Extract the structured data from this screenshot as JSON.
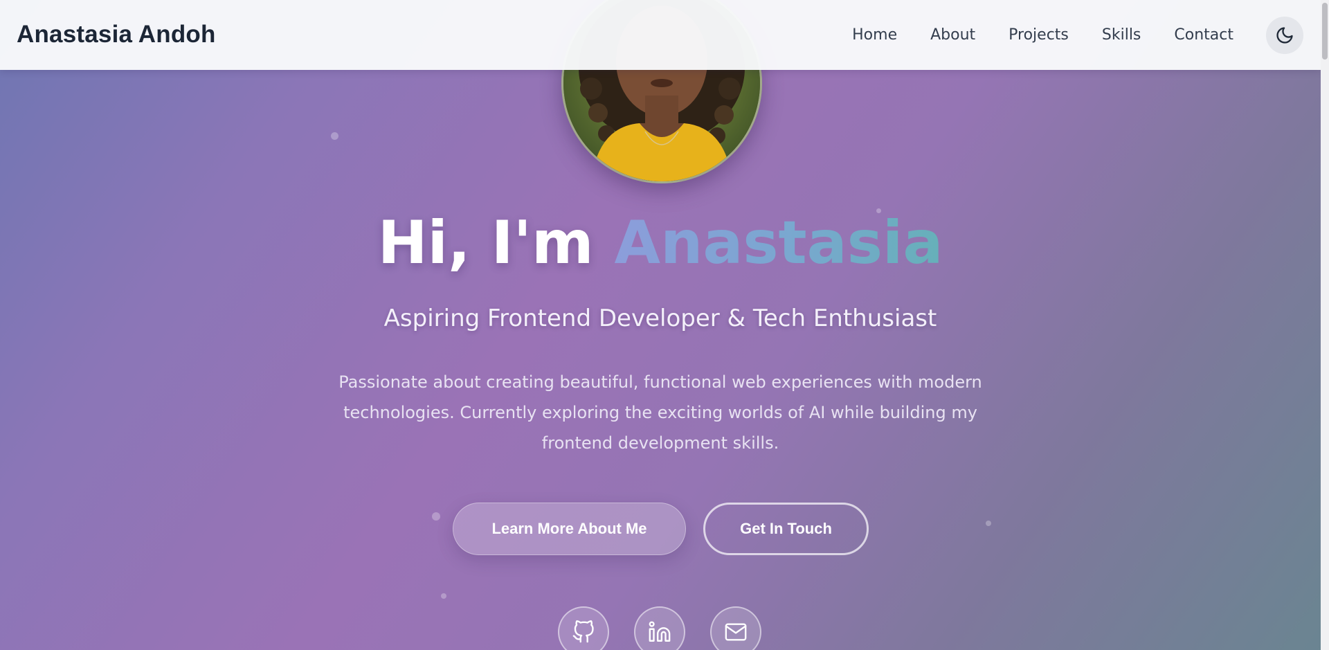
{
  "brand": {
    "name": "Anastasia Andoh"
  },
  "nav": {
    "links": [
      "Home",
      "About",
      "Projects",
      "Skills",
      "Contact"
    ],
    "theme_toggle_icon": "moon-icon"
  },
  "hero": {
    "greeting": "Hi, I'm",
    "name": "Anastasia",
    "subtitle": "Aspiring Frontend Developer & Tech Enthusiast",
    "description": "Passionate about creating beautiful, functional web experiences with modern technologies. Currently exploring the exciting worlds of AI while building my frontend development skills.",
    "primary_button": "Learn More About Me",
    "secondary_button": "Get In Touch"
  },
  "social": {
    "icons": [
      "github-icon",
      "linkedin-icon",
      "mail-icon"
    ]
  },
  "colors": {
    "brand_text": "#1c2636",
    "nav_text": "#333d4d",
    "gradient_start": "#6e76b2",
    "gradient_mid": "#9a73b6",
    "gradient_end": "#6a8591",
    "name_gradient_start": "#8c9ddb",
    "name_gradient_end": "#66b0b9"
  }
}
